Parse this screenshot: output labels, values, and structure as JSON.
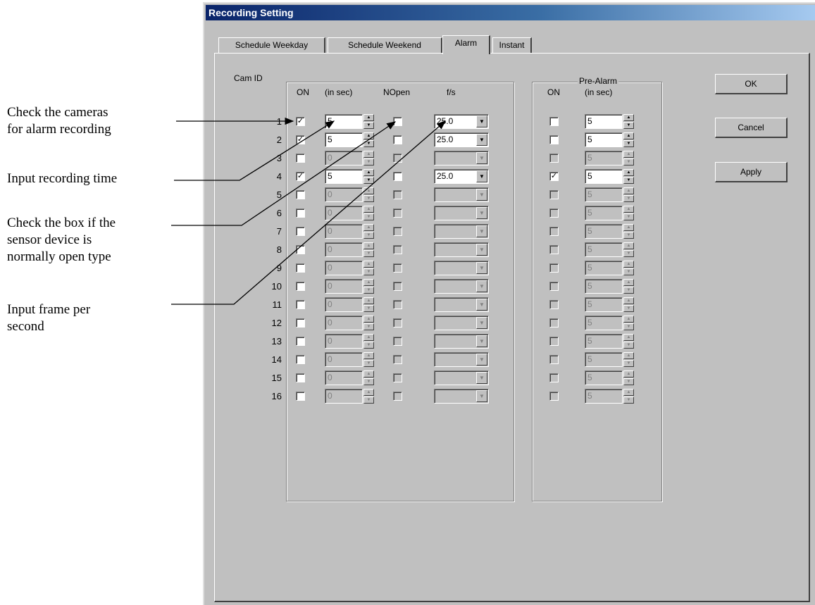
{
  "annotations": {
    "cameras": "Check the cameras\nfor alarm recording",
    "time": "Input recording time",
    "normally_open": "Check the box if the\nsensor device is\nnormally open type",
    "fps": "Input frame per\nsecond"
  },
  "window": {
    "title": "Recording Setting"
  },
  "tabs": [
    "Schedule Weekday",
    "Schedule Weekend",
    "Alarm",
    "Instant"
  ],
  "active_tab": "Alarm",
  "headers": {
    "cam_id": "Cam ID",
    "on": "ON",
    "in_sec": "(in sec)",
    "nopen": "NOpen",
    "fps": "f/s",
    "pre_alarm": "Pre-Alarm",
    "pre_on": "ON",
    "pre_in_sec": "(in sec)"
  },
  "buttons": {
    "ok": "OK",
    "cancel": "Cancel",
    "apply": "Apply"
  },
  "rows": [
    {
      "id": "1",
      "on": true,
      "secs": "5",
      "nopen": false,
      "fps": "25.0",
      "pre_on": false,
      "pre_secs": "5",
      "enabled": true,
      "pre_enabled": true
    },
    {
      "id": "2",
      "on": true,
      "secs": "5",
      "nopen": false,
      "fps": "25.0",
      "pre_on": false,
      "pre_secs": "5",
      "enabled": true,
      "pre_enabled": true
    },
    {
      "id": "3",
      "on": false,
      "secs": "0",
      "nopen": false,
      "fps": "",
      "pre_on": false,
      "pre_secs": "5",
      "enabled": false,
      "pre_enabled": false
    },
    {
      "id": "4",
      "on": true,
      "secs": "5",
      "nopen": false,
      "fps": "25.0",
      "pre_on": true,
      "pre_secs": "5",
      "enabled": true,
      "pre_enabled": true
    },
    {
      "id": "5",
      "on": false,
      "secs": "0",
      "nopen": false,
      "fps": "",
      "pre_on": false,
      "pre_secs": "5",
      "enabled": false,
      "pre_enabled": false
    },
    {
      "id": "6",
      "on": false,
      "secs": "0",
      "nopen": false,
      "fps": "",
      "pre_on": false,
      "pre_secs": "5",
      "enabled": false,
      "pre_enabled": false
    },
    {
      "id": "7",
      "on": false,
      "secs": "0",
      "nopen": false,
      "fps": "",
      "pre_on": false,
      "pre_secs": "5",
      "enabled": false,
      "pre_enabled": false
    },
    {
      "id": "8",
      "on": false,
      "secs": "0",
      "nopen": false,
      "fps": "",
      "pre_on": false,
      "pre_secs": "5",
      "enabled": false,
      "pre_enabled": false
    },
    {
      "id": "9",
      "on": false,
      "secs": "0",
      "nopen": false,
      "fps": "",
      "pre_on": false,
      "pre_secs": "5",
      "enabled": false,
      "pre_enabled": false
    },
    {
      "id": "10",
      "on": false,
      "secs": "0",
      "nopen": false,
      "fps": "",
      "pre_on": false,
      "pre_secs": "5",
      "enabled": false,
      "pre_enabled": false
    },
    {
      "id": "11",
      "on": false,
      "secs": "0",
      "nopen": false,
      "fps": "",
      "pre_on": false,
      "pre_secs": "5",
      "enabled": false,
      "pre_enabled": false
    },
    {
      "id": "12",
      "on": false,
      "secs": "0",
      "nopen": false,
      "fps": "",
      "pre_on": false,
      "pre_secs": "5",
      "enabled": false,
      "pre_enabled": false
    },
    {
      "id": "13",
      "on": false,
      "secs": "0",
      "nopen": false,
      "fps": "",
      "pre_on": false,
      "pre_secs": "5",
      "enabled": false,
      "pre_enabled": false
    },
    {
      "id": "14",
      "on": false,
      "secs": "0",
      "nopen": false,
      "fps": "",
      "pre_on": false,
      "pre_secs": "5",
      "enabled": false,
      "pre_enabled": false
    },
    {
      "id": "15",
      "on": false,
      "secs": "0",
      "nopen": false,
      "fps": "",
      "pre_on": false,
      "pre_secs": "5",
      "enabled": false,
      "pre_enabled": false
    },
    {
      "id": "16",
      "on": false,
      "secs": "0",
      "nopen": false,
      "fps": "",
      "pre_on": false,
      "pre_secs": "5",
      "enabled": false,
      "pre_enabled": false
    }
  ]
}
